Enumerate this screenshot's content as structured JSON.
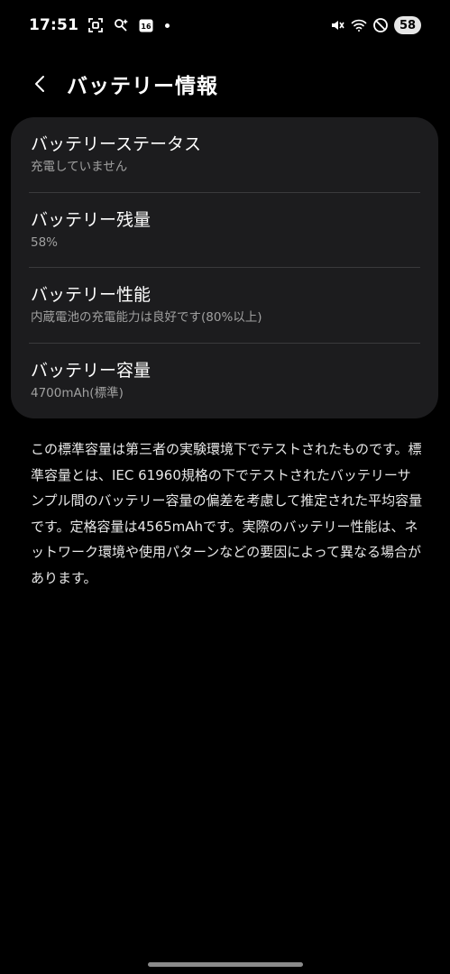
{
  "status_bar": {
    "time": "17:51",
    "calendar_day": "16",
    "battery_percent": "58"
  },
  "header": {
    "title": "バッテリー情報"
  },
  "items": [
    {
      "title": "バッテリーステータス",
      "subtitle": "充電していません"
    },
    {
      "title": "バッテリー残量",
      "subtitle": "58%"
    },
    {
      "title": "バッテリー性能",
      "subtitle": "内蔵電池の充電能力は良好です(80%以上)"
    },
    {
      "title": "バッテリー容量",
      "subtitle": "4700mAh(標準)"
    }
  ],
  "description": "この標準容量は第三者の実験環境下でテストされたものです。標準容量とは、IEC 61960規格の下でテストされたバッテリーサンプル間のバッテリー容量の偏差を考慮して推定された平均容量です。定格容量は4565mAhです。実際のバッテリー性能は、ネットワーク環境や使用パターンなどの要因によって異なる場合があります。",
  "colors": {
    "background": "#000000",
    "card": "#1c1c1e",
    "divider": "#3a3a3c",
    "subtitle": "#a0a0a0"
  },
  "icons": {
    "status_left": [
      "screenshot-icon",
      "accessibility-icon",
      "calendar-icon"
    ],
    "status_right": [
      "mute-icon",
      "wifi-icon",
      "do-not-disturb-icon"
    ],
    "back": "chevron-left-icon"
  }
}
